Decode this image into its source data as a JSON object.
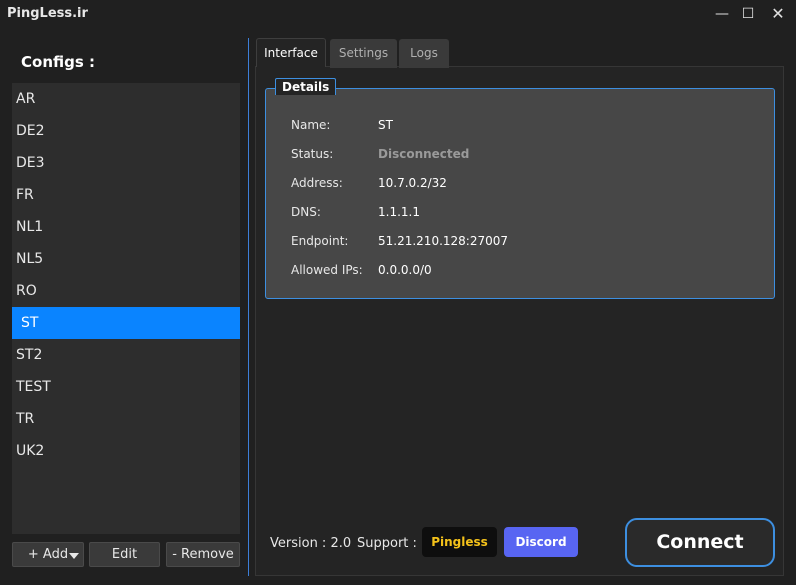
{
  "window": {
    "title": "PingLess.ir",
    "minimize_glyph": "—",
    "maximize_glyph": "☐",
    "close_glyph": "✕"
  },
  "configs": {
    "label": "Configs :",
    "items": [
      "AR",
      "DE2",
      "DE3",
      "FR",
      "NL1",
      "NL5",
      "RO",
      "ST",
      "ST2",
      "TEST",
      "TR",
      "UK2"
    ],
    "selected": "ST"
  },
  "config_buttons": {
    "add": "+ Add",
    "edit": "Edit",
    "remove": "- Remove"
  },
  "tabs": {
    "interface": "Interface",
    "settings": "Settings",
    "logs": "Logs",
    "active": "Interface"
  },
  "details": {
    "legend": "Details",
    "name_label": "Name:",
    "name_value": "ST",
    "status_label": "Status:",
    "status_value": "Disconnected",
    "address_label": "Address:",
    "address_value": "10.7.0.2/32",
    "dns_label": "DNS:",
    "dns_value": "1.1.1.1",
    "endpoint_label": "Endpoint:",
    "endpoint_value": "51.21.210.128:27007",
    "allowed_label": "Allowed IPs:",
    "allowed_value": "0.0.0.0/0"
  },
  "footer": {
    "version": "Version : 2.0",
    "support": "Support :",
    "pingless": "Pingless",
    "discord": "Discord",
    "connect": "Connect"
  },
  "colors": {
    "accent": "#0a84ff",
    "border_accent": "#3d8fe0",
    "pingless_text": "#f4c21a",
    "discord": "#5865f2"
  }
}
